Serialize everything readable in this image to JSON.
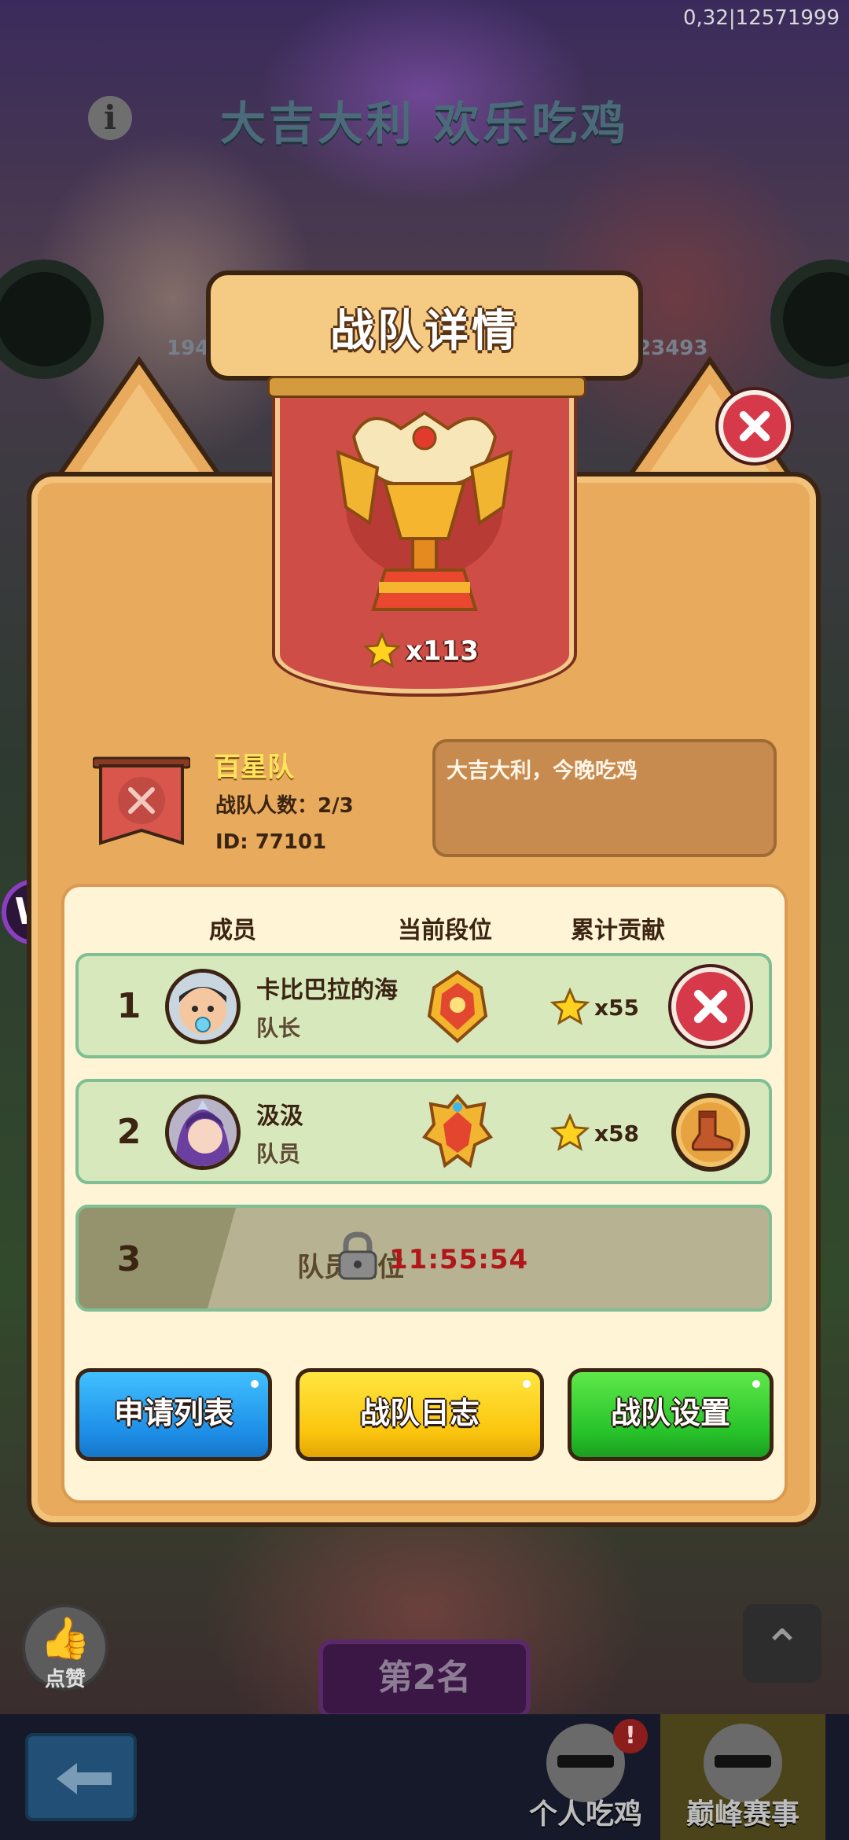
{
  "status": {
    "debug_text": "0,32|12571999"
  },
  "background": {
    "event_title": "大吉大利 欢乐吃鸡",
    "left_player_num": "194",
    "right_player_num": "23493",
    "like_label": "点赞",
    "rank_label": "第2名"
  },
  "bottom_nav": {
    "tabs": [
      {
        "label": "个人吃鸡",
        "alert": "!"
      },
      {
        "label": "巅峰赛事"
      }
    ]
  },
  "dialog": {
    "title": "战队详情",
    "trophy_stars": "x113",
    "team": {
      "name": "百星队",
      "member_count": "战队人数：2/3",
      "id": "ID: 77101",
      "motto": "大吉大利，今晚吃鸡"
    },
    "columns": {
      "member": "成员",
      "rank": "当前段位",
      "contribution": "累计贡献"
    },
    "members": [
      {
        "index": "1",
        "name": "卡比巴拉的海",
        "role": "队长",
        "contribution": "x55",
        "action": "remove"
      },
      {
        "index": "2",
        "name": "汲汲",
        "role": "队员",
        "contribution": "x58",
        "action": "kick"
      }
    ],
    "locked_slot": {
      "index": "3",
      "label": "队员空位",
      "timer": "11:55:54"
    },
    "buttons": {
      "apply_list": "申请列表",
      "team_log": "战队日志",
      "team_settings": "战队设置"
    }
  },
  "colors": {
    "panel": "#e8ab5d",
    "banner": "#cf4d47",
    "close_red": "#d6394a",
    "team_name_yellow": "#ffe45c",
    "timer_red": "#b0161a"
  }
}
